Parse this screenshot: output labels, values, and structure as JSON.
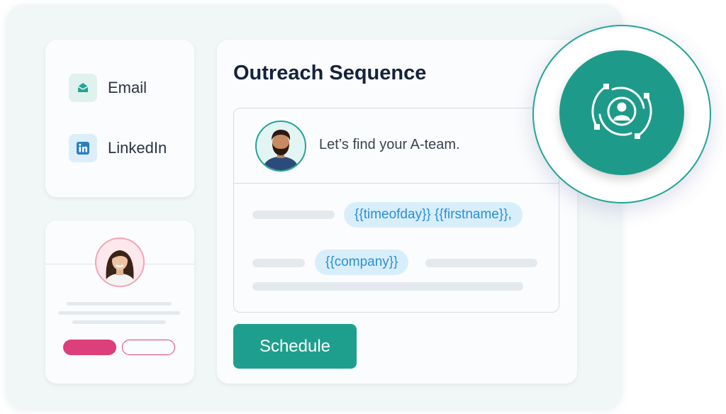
{
  "channels": {
    "items": [
      {
        "label": "Email",
        "icon": "email-icon",
        "icon_bg": "#dff2ee",
        "icon_color": "#23a595"
      },
      {
        "label": "LinkedIn",
        "icon": "linkedin-icon",
        "icon_bg": "#dceefa",
        "icon_color": "#2a7fc4"
      }
    ]
  },
  "sequence": {
    "title": "Outreach Sequence",
    "greeting": "Let’s find your A-team.",
    "tags": {
      "timeofday_firstname": "{{timeofday}} {{firstname}},",
      "company": "{{company}}"
    },
    "schedule_label": "Schedule"
  },
  "colors": {
    "accent": "#1e9f8e",
    "pink": "#dd3f7a",
    "tag_text": "#2a8fd8",
    "title": "#15223b"
  },
  "badge": {
    "icon": "target-user-icon"
  }
}
